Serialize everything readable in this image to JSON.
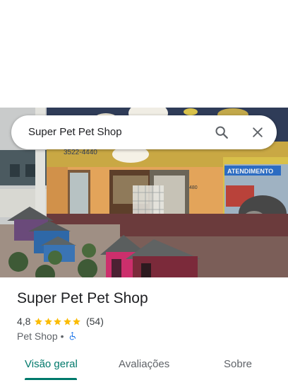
{
  "search": {
    "query": "Super Pet Pet Shop",
    "search_icon": "search-icon",
    "close_icon": "close-icon"
  },
  "place": {
    "name": "Super Pet Pet Shop",
    "rating": "4,8",
    "stars": 5,
    "reviews": "(54)",
    "category": "Pet Shop",
    "separator": "•",
    "accessibility_icon": "wheelchair-icon"
  },
  "tabs": [
    {
      "label": "Visão geral",
      "active": true
    },
    {
      "label": "Avaliações",
      "active": false
    },
    {
      "label": "Sobre",
      "active": false
    }
  ],
  "photo": {
    "storefront_sign": "ATENDIMENTO",
    "store_phone": "3522-4440",
    "street_number": "480"
  },
  "colors": {
    "accent": "#00796b",
    "star": "#fbbc04",
    "accessibility": "#1a73e8"
  }
}
